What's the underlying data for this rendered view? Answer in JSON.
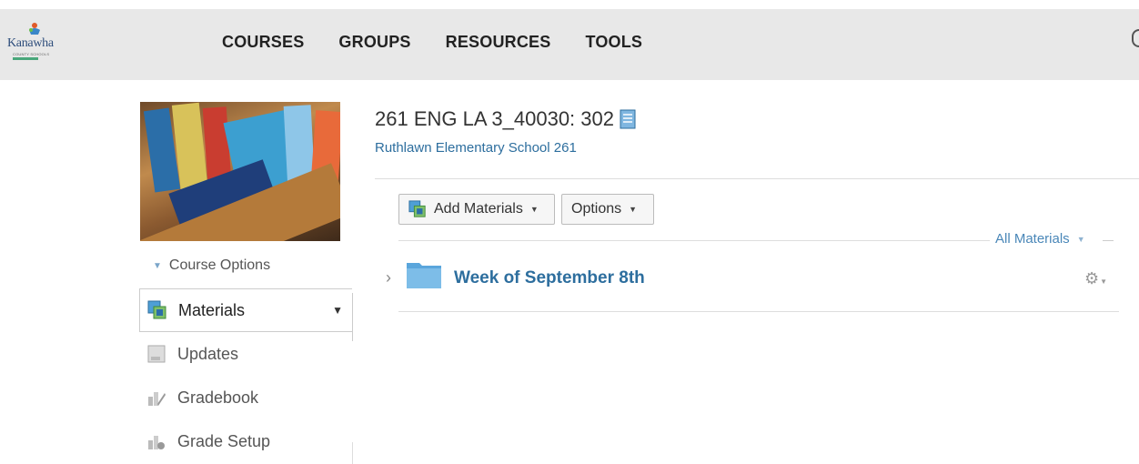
{
  "header": {
    "logo_text": "Kanawha",
    "logo_subtext": "COUNTY SCHOOLS",
    "nav": [
      "COURSES",
      "GROUPS",
      "RESOURCES",
      "TOOLS"
    ]
  },
  "sidebar": {
    "course_options_label": "Course Options",
    "items": [
      {
        "label": "Materials",
        "active": true
      },
      {
        "label": "Updates"
      },
      {
        "label": "Gradebook"
      },
      {
        "label": "Grade Setup"
      }
    ]
  },
  "main": {
    "course_title": "261 ENG LA 3_40030: 302",
    "school": "Ruthlawn Elementary School 261",
    "add_materials_label": "Add Materials",
    "options_label": "Options",
    "filter_label": "All Materials",
    "folders": [
      {
        "title": "Week of September 8th"
      }
    ]
  },
  "colors": {
    "link_blue": "#2d6e9e",
    "header_bg": "#e8e8e8",
    "folder_blue": "#6bb0e0"
  }
}
